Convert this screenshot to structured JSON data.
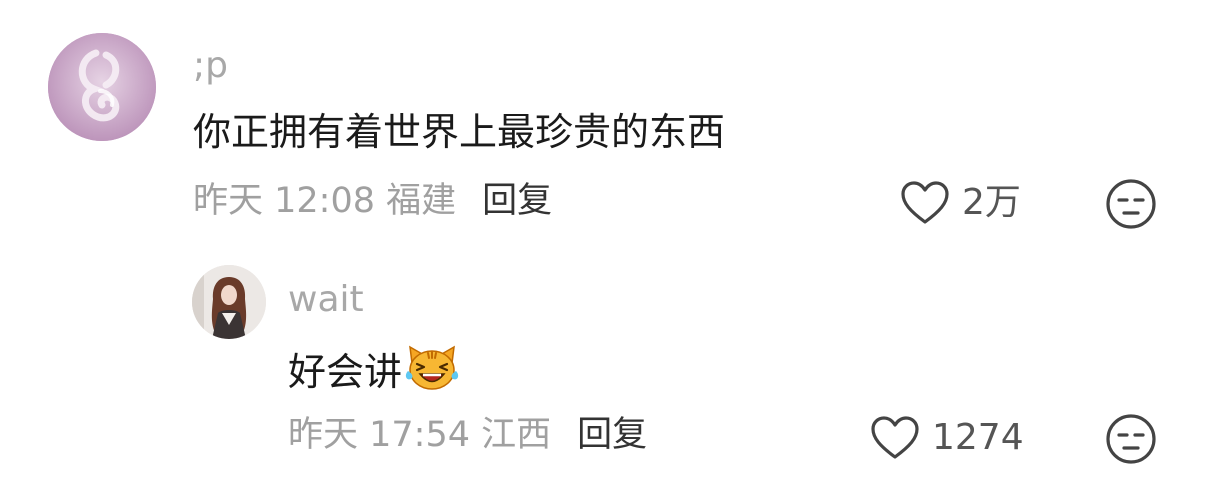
{
  "comments": [
    {
      "username": ";p",
      "text": "你正拥有着世界上最珍贵的东西",
      "time": "昨天 12:08 福建",
      "reply_label": "回复",
      "likes": "2万",
      "avatar_icon": "feather-swirl-avatar",
      "avatar_color": "#c7a5c6"
    },
    {
      "username": "wait",
      "text": "好会讲",
      "emoji": "crying-laughing-cat-emoji",
      "time": "昨天 17:54 江西",
      "reply_label": "回复",
      "likes": "1274",
      "avatar_icon": "girl-photo-avatar"
    }
  ],
  "colors": {
    "meta_text": "#a0a0a0",
    "username": "#a8a8a8",
    "body_text": "#1a1a1a",
    "reply": "#333333",
    "icon_stroke": "#444444"
  }
}
